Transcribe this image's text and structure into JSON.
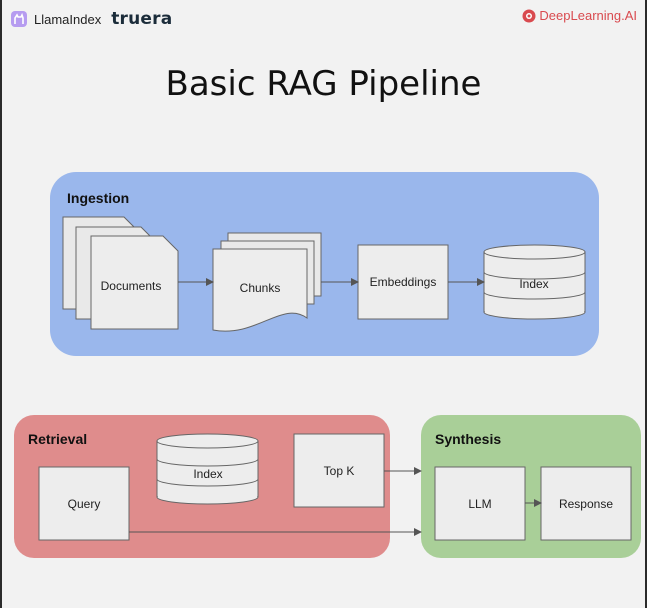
{
  "header": {
    "llamaindex": "LlamaIndex",
    "truera": "truera",
    "deeplearning": "DeepLearning.AI",
    "title": "Basic RAG Pipeline"
  },
  "groups": {
    "ingestion": {
      "label": "Ingestion",
      "color": "#9ab7ec"
    },
    "retrieval": {
      "label": "Retrieval",
      "color": "#df8c8c"
    },
    "synthesis": {
      "label": "Synthesis",
      "color": "#a9cf98"
    }
  },
  "nodes": {
    "documents": "Documents",
    "chunks": "Chunks",
    "embeddings": "Embeddings",
    "index_ingestion": "Index",
    "query": "Query",
    "index_retrieval": "Index",
    "top_k": "Top K",
    "llm": "LLM",
    "response": "Response"
  },
  "icons": {
    "llamaindex": "llama-icon",
    "deeplearning": "deeplearning-logo-icon"
  }
}
